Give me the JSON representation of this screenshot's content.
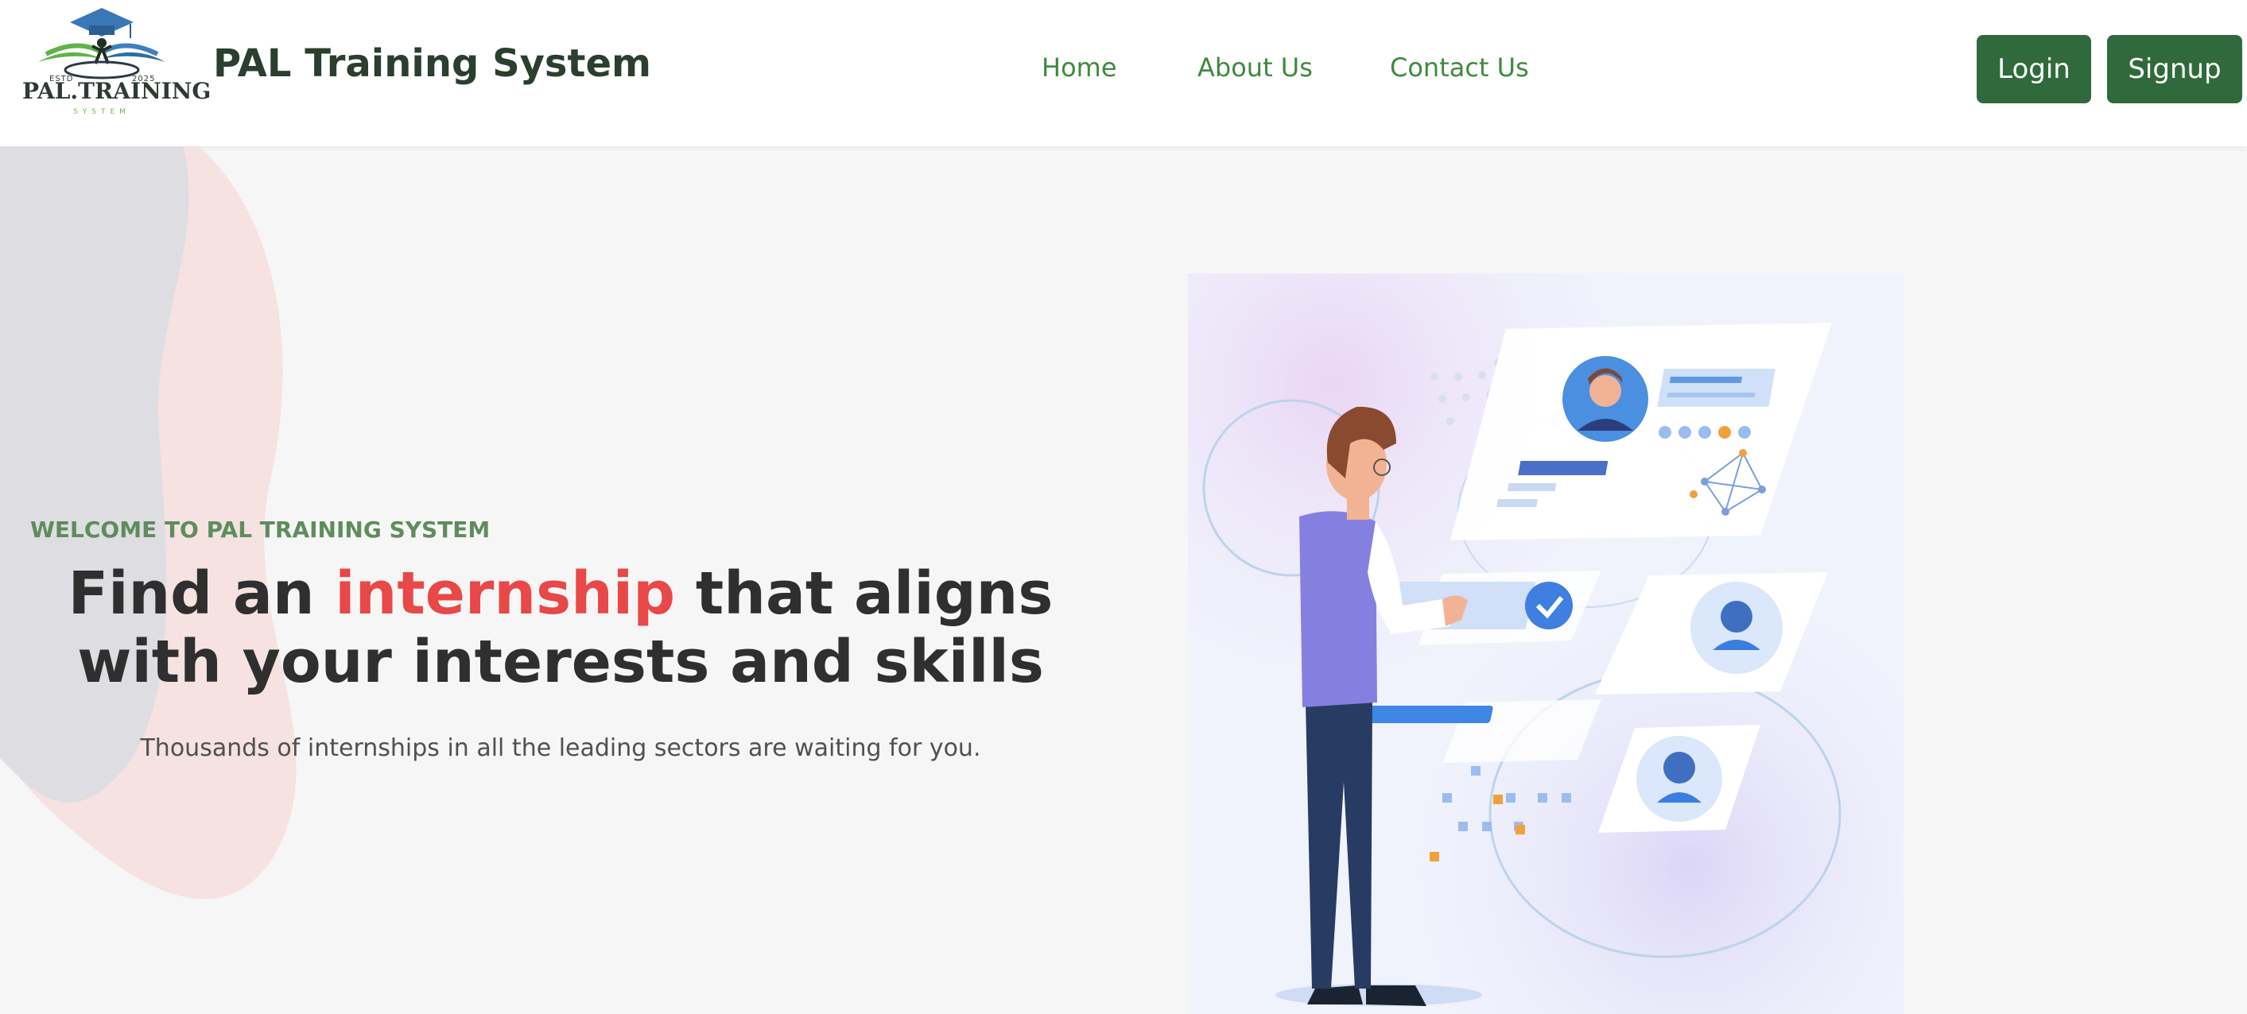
{
  "header": {
    "logo": {
      "est": "ESTD",
      "year": "2025",
      "name": "PAL.TRAINING",
      "tagline": "SYSTEM",
      "icon": "graduation-cap-logo-icon"
    },
    "brand_title": "PAL Training System",
    "nav": [
      {
        "label": "Home"
      },
      {
        "label": "About Us"
      },
      {
        "label": "Contact Us"
      }
    ],
    "login_label": "Login",
    "signup_label": "Signup"
  },
  "hero": {
    "welcome": "WELCOME TO PAL TRAINING SYSTEM",
    "headline_before": "Find an ",
    "headline_highlight": "internship",
    "headline_after": " that aligns with your interests and skills",
    "subtext": "Thousands of internships in all the leading sectors are waiting for you.",
    "illustration_icon": "person-selecting-candidate-profiles-illustration"
  },
  "colors": {
    "brand_green": "#306a3c",
    "nav_green": "#3e8a3e",
    "highlight_red": "#e84848",
    "welcome_green": "#5e8d5b"
  }
}
